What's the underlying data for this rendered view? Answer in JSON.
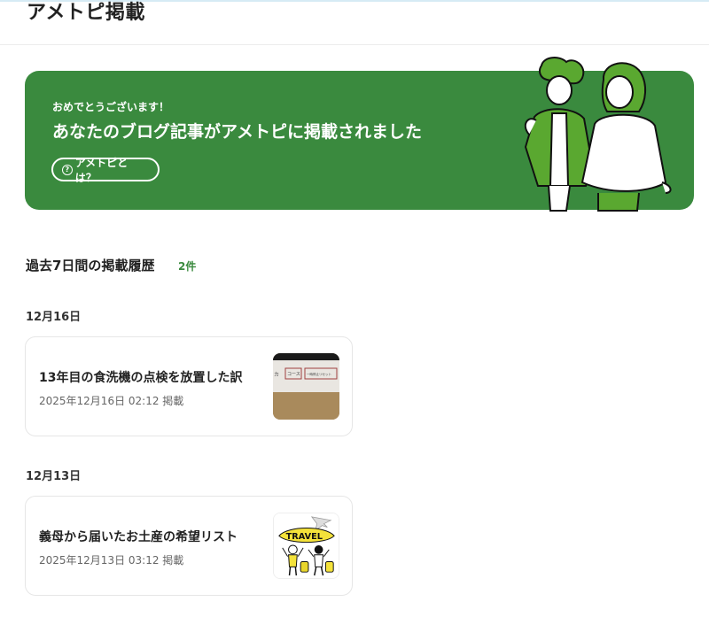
{
  "header": {
    "title": "アメトピ掲載"
  },
  "banner": {
    "congrats": "おめでとうございます！",
    "headline": "あなたのブログ記事がアメトピに掲載されました",
    "about_label": "アメトピとは？",
    "question_icon": "?"
  },
  "history": {
    "title": "過去7日間の掲載履歴",
    "count": "2件",
    "groups": [
      {
        "date": "12月16日",
        "title": "13年目の食洗機の点検を放置した訳",
        "meta": "2025年12月16日 02:12 掲載",
        "thumb_labels": [
          "カ",
          "コース",
          "一時停止リセット"
        ]
      },
      {
        "date": "12月13日",
        "title": "義母から届いたお土産の希望リスト",
        "meta": "2025年12月13日 03:12 掲載",
        "thumb_labels": [
          "TRAVEL"
        ]
      }
    ]
  },
  "colors": {
    "brand_green": "#3a8a3e",
    "illust_green": "#5aa830"
  }
}
